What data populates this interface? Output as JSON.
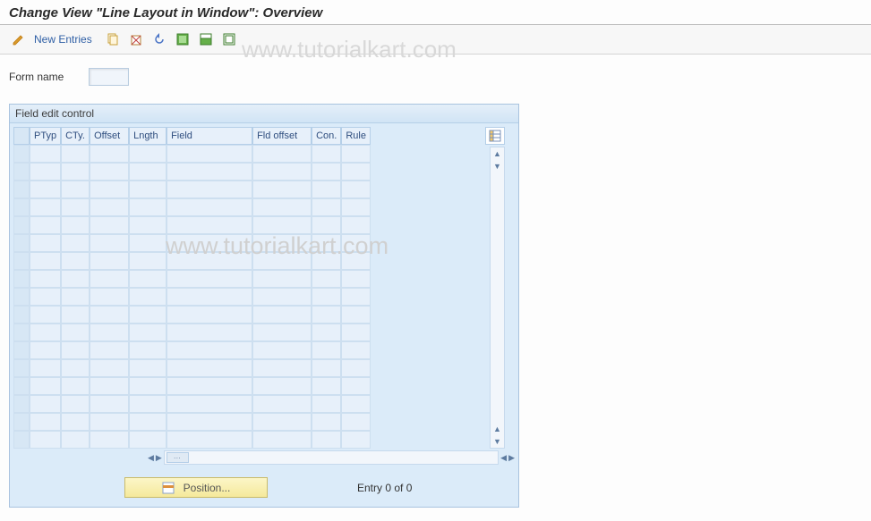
{
  "header": {
    "title": "Change View \"Line Layout in Window\": Overview"
  },
  "toolbar": {
    "new_entries": "New Entries"
  },
  "form": {
    "name_label": "Form name",
    "name_value": ""
  },
  "panel": {
    "title": "Field edit control",
    "columns": {
      "ptyp": "PTyp",
      "cty": "CTy.",
      "offset": "Offset",
      "lngth": "Lngth",
      "field": "Field",
      "fldoff": "Fld offset",
      "con": "Con.",
      "rule": "Rule"
    },
    "visible_rows": 17,
    "position_label": "Position...",
    "entry_text": "Entry 0 of 0"
  },
  "watermark": "www.tutorialkart.com"
}
